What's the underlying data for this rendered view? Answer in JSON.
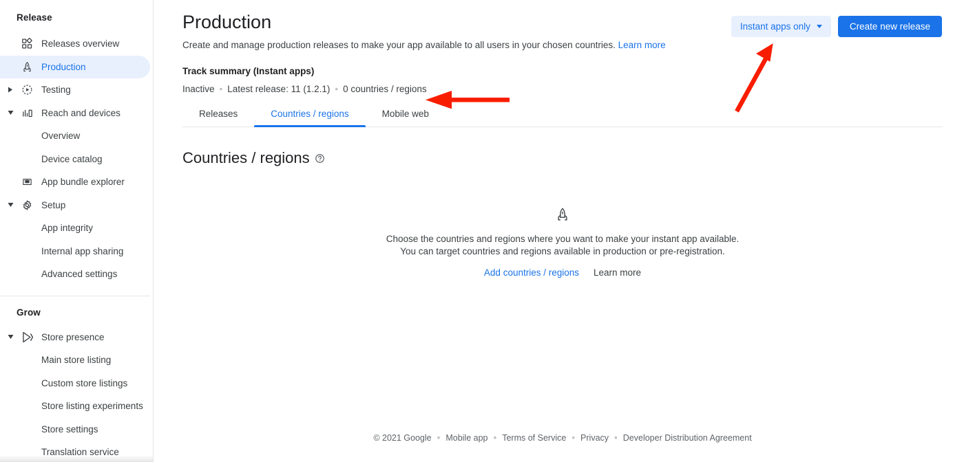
{
  "sidebar": {
    "sections": [
      {
        "title": "Release",
        "items": [
          {
            "label": "Releases overview",
            "icon": "dashboard-icon",
            "level": "top",
            "caret": "none",
            "active": false
          },
          {
            "label": "Production",
            "icon": "rocket-icon",
            "level": "top",
            "caret": "none",
            "active": true
          },
          {
            "label": "Testing",
            "icon": "play-circle-dashed-icon",
            "level": "top",
            "caret": "collapsed",
            "active": false
          },
          {
            "label": "Reach and devices",
            "icon": "bar-chart-icon",
            "level": "top",
            "caret": "expanded",
            "active": false
          },
          {
            "label": "Overview",
            "icon": "none",
            "level": "sub",
            "caret": "none",
            "active": false
          },
          {
            "label": "Device catalog",
            "icon": "none",
            "level": "sub",
            "caret": "none",
            "active": false
          },
          {
            "label": "App bundle explorer",
            "icon": "android-bundle-icon",
            "level": "top",
            "caret": "none",
            "active": false
          },
          {
            "label": "Setup",
            "icon": "gear-icon",
            "level": "top",
            "caret": "expanded",
            "active": false
          },
          {
            "label": "App integrity",
            "icon": "none",
            "level": "sub",
            "caret": "none",
            "active": false
          },
          {
            "label": "Internal app sharing",
            "icon": "none",
            "level": "sub",
            "caret": "none",
            "active": false
          },
          {
            "label": "Advanced settings",
            "icon": "none",
            "level": "sub",
            "caret": "none",
            "active": false
          }
        ]
      },
      {
        "title": "Grow",
        "items": [
          {
            "label": "Store presence",
            "icon": "play-store-icon",
            "level": "top",
            "caret": "expanded",
            "active": false
          },
          {
            "label": "Main store listing",
            "icon": "none",
            "level": "sub",
            "caret": "none",
            "active": false
          },
          {
            "label": "Custom store listings",
            "icon": "none",
            "level": "sub",
            "caret": "none",
            "active": false
          },
          {
            "label": "Store listing experiments",
            "icon": "none",
            "level": "sub",
            "caret": "none",
            "active": false
          },
          {
            "label": "Store settings",
            "icon": "none",
            "level": "sub",
            "caret": "none",
            "active": false
          },
          {
            "label": "Translation service",
            "icon": "none",
            "level": "sub",
            "caret": "none",
            "active": false
          }
        ]
      }
    ]
  },
  "header": {
    "title": "Production",
    "description": "Create and manage production releases to make your app available to all users in your chosen countries.",
    "description_link": "Learn more",
    "filter_button": "Instant apps only",
    "primary_button": "Create new release"
  },
  "track_summary": {
    "title": "Track summary (Instant apps)",
    "status": "Inactive",
    "latest_release": "Latest release: 11 (1.2.1)",
    "countries": "0 countries / regions",
    "separator": "•"
  },
  "tabs": [
    {
      "label": "Releases",
      "active": false
    },
    {
      "label": "Countries / regions",
      "active": true
    },
    {
      "label": "Mobile web",
      "active": false
    }
  ],
  "section": {
    "title": "Countries / regions",
    "help_icon": "help-circle-icon"
  },
  "empty_state": {
    "icon": "rocket-icon",
    "line1": "Choose the countries and regions where you want to make your instant app available.",
    "line2": "You can target countries and regions available in production or pre-registration.",
    "primary_link": "Add countries / regions",
    "secondary_link": "Learn more"
  },
  "footer": {
    "copyright": "© 2021 Google",
    "separator": "•",
    "links": [
      "Mobile app",
      "Terms of Service",
      "Privacy",
      "Developer Distribution Agreement"
    ]
  },
  "annotations": {
    "arrow_color": "#f91d00",
    "arrow_left_label": "arrow pointing at track summary",
    "arrow_diagonal_label": "arrow pointing at instant apps only filter"
  },
  "colors": {
    "accent_blue": "#1a73e8",
    "tonal_blue_bg": "#e8f0fe",
    "text_primary": "#202124",
    "text_secondary": "#3c4043",
    "border": "#e4e6e8"
  }
}
